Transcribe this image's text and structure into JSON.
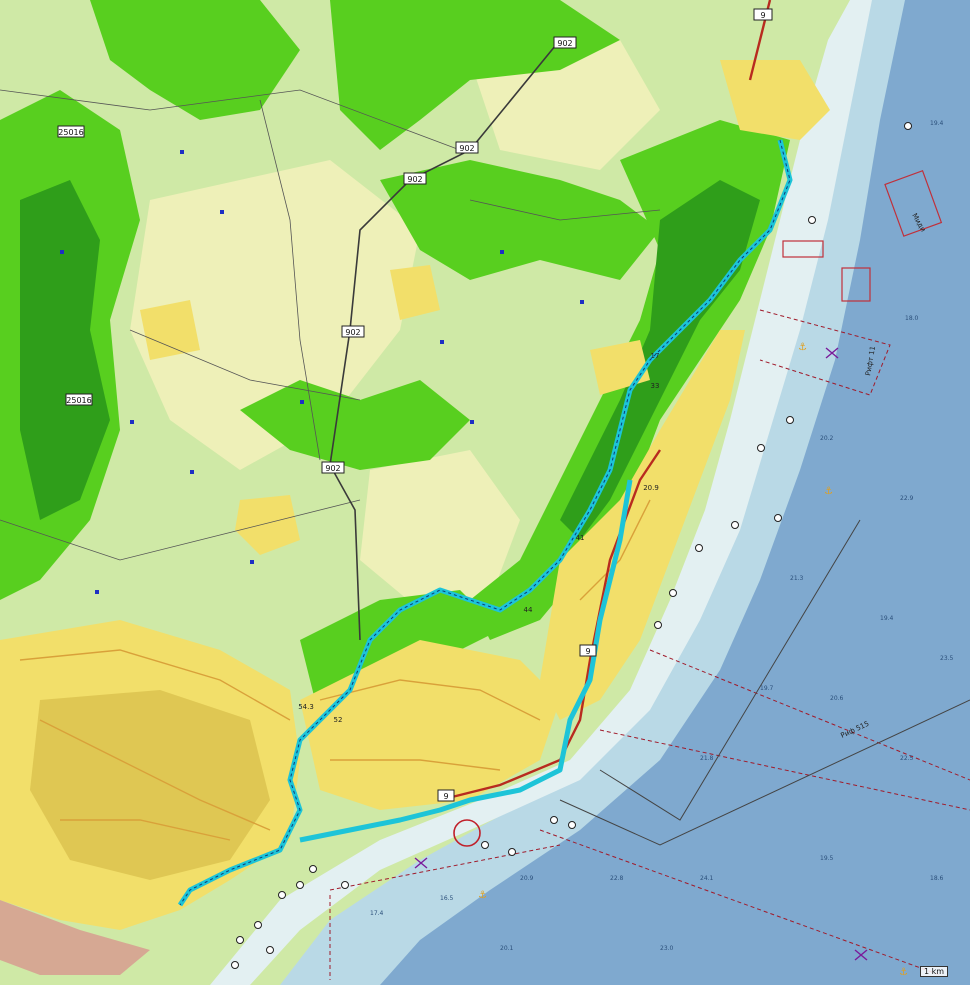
{
  "map": {
    "colors": {
      "sea_deep": "#7fa9cf",
      "sea_shallow": "#b9d9e6",
      "sea_coast": "#e3f0f2",
      "forest": "#58cf1f",
      "forest_dark": "#2f9e1a",
      "meadow": "#c9ea92",
      "field": "#eef0b8",
      "urban": "#f2df6a",
      "urban_dense": "#cfb23f",
      "road_major": "#b82b1f",
      "road_minor": "#d9a13a",
      "track": "#1dc4d8",
      "marine_line": "#a01b2b"
    },
    "road_shields": [
      {
        "label": "9"
      },
      {
        "label": "902"
      },
      {
        "label": "902"
      },
      {
        "label": "902"
      },
      {
        "label": "902"
      },
      {
        "label": "902"
      },
      {
        "label": "25016"
      },
      {
        "label": "25016"
      },
      {
        "label": "9"
      },
      {
        "label": "9"
      }
    ],
    "route_numbers": [
      "17",
      "33",
      "41",
      "44",
      "54.3",
      "52",
      "20.9"
    ],
    "marine_labels": [
      "Риф 515",
      "Рифт 11",
      "Миди"
    ],
    "depths": [
      "19.4",
      "18.0",
      "20.2",
      "22.9",
      "21.3",
      "19.4",
      "23.5",
      "19.7",
      "20.6",
      "21.8",
      "22.5",
      "17.4",
      "16.5",
      "20.9",
      "22.8",
      "24.1",
      "19.5",
      "18.6",
      "20.1",
      "23.0"
    ],
    "scale_label": "1 km"
  }
}
